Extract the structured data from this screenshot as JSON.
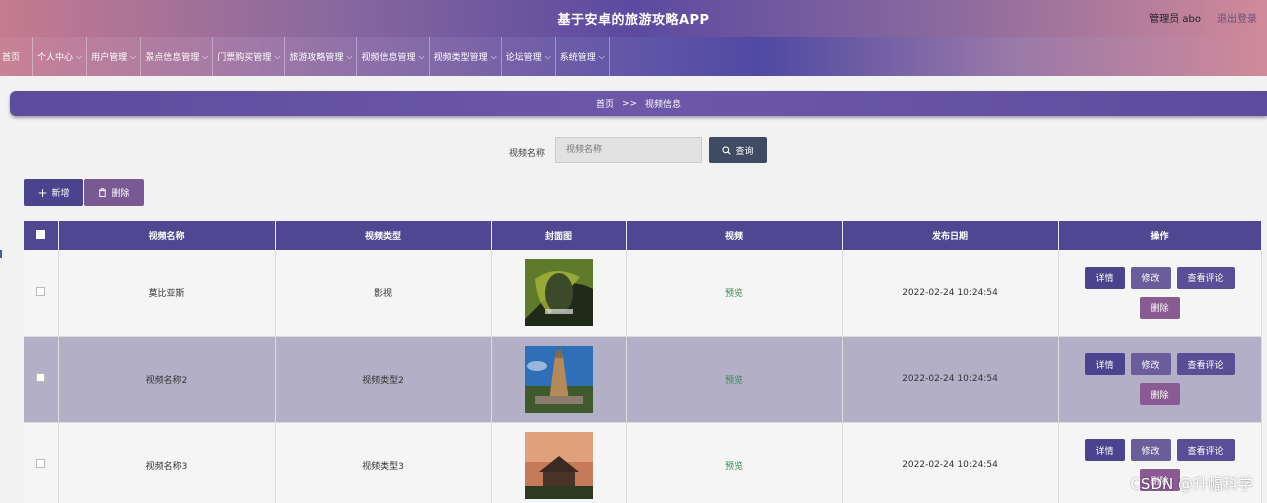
{
  "app": {
    "title": "基于安卓的旅游攻略APP",
    "admin_label": "管理员 abo",
    "logout_label": "退出登录"
  },
  "nav": {
    "items": [
      {
        "label": "首页",
        "has_dropdown": false
      },
      {
        "label": "个人中心",
        "has_dropdown": true
      },
      {
        "label": "用户管理",
        "has_dropdown": true
      },
      {
        "label": "景点信息管理",
        "has_dropdown": true
      },
      {
        "label": "门票购买管理",
        "has_dropdown": true
      },
      {
        "label": "旅游攻略管理",
        "has_dropdown": true
      },
      {
        "label": "视频信息管理",
        "has_dropdown": true
      },
      {
        "label": "视频类型管理",
        "has_dropdown": true
      },
      {
        "label": "论坛管理",
        "has_dropdown": true
      },
      {
        "label": "系统管理",
        "has_dropdown": true
      }
    ]
  },
  "breadcrumb": {
    "home": "首页",
    "sep": ">>",
    "current": "视频信息"
  },
  "search": {
    "label": "视频名称",
    "placeholder": "视频名称",
    "button": "查询"
  },
  "actions": {
    "add": "新增",
    "delete": "删除"
  },
  "table": {
    "headers": [
      "视频名称",
      "视频类型",
      "封面图",
      "视频",
      "发布日期",
      "操作"
    ],
    "rows": [
      {
        "name": "莫比亚斯",
        "type": "影视",
        "video": "预览",
        "date": "2022-02-24 10:24:54"
      },
      {
        "name": "视频名称2",
        "type": "视频类型2",
        "video": "预览",
        "date": "2022-02-24 10:24:54"
      },
      {
        "name": "视频名称3",
        "type": "视频类型3",
        "video": "预览",
        "date": "2022-02-24 10:24:54"
      }
    ],
    "ops": {
      "detail": "详情",
      "edit": "修改",
      "comments": "查看评论",
      "delete": "删除"
    }
  },
  "watermark": "CSDN @升幅科学",
  "colors": {
    "primary": "#4f4791",
    "accent": "#8a5a92",
    "search_button": "#3f4a63",
    "preview_link": "#3a8a56"
  }
}
